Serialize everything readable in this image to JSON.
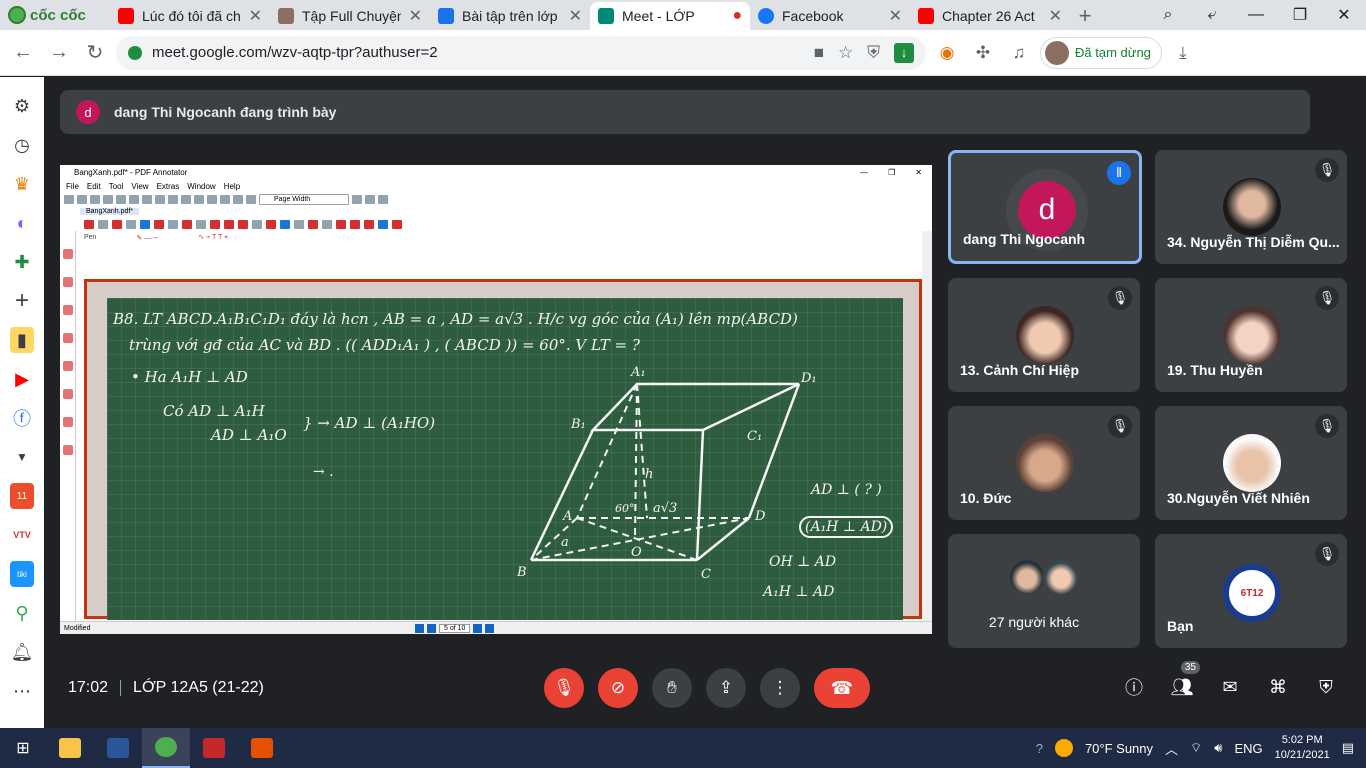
{
  "browser": {
    "brand": "cốc cốc",
    "tabs": [
      {
        "title": "Lúc đó tôi đã ch",
        "color": "#ff0000"
      },
      {
        "title": "Tập Full Chuyện",
        "color": "#8d6e63"
      },
      {
        "title": "Bài tập trên lớp",
        "color": "#1a73e8"
      },
      {
        "title": "Meet - LỚP",
        "color": "#00897b",
        "active": true
      },
      {
        "title": "Facebook",
        "color": "#1877f2"
      },
      {
        "title": "Chapter 26 Act",
        "color": "#ff0000"
      }
    ],
    "url": "meet.google.com/wzv-aqtp-tpr?authuser=2",
    "profile_status": "Đã tạm dừng"
  },
  "meet": {
    "presenting_initial": "d",
    "presenting_banner": "dang Thi Ngocanh đang trình bày",
    "time": "17:02",
    "meeting_name": "LỚP 12A5 (21-22)",
    "participant_count": "35"
  },
  "participants": [
    {
      "name": "dang Thi Ngocanh",
      "initial": "d",
      "speaking": true
    },
    {
      "name": "34. Nguyễn Thị Diễm Qu...",
      "speaking": false
    },
    {
      "name": "13. Cảnh Chí Hiệp",
      "speaking": false
    },
    {
      "name": "19. Thu Huyền",
      "speaking": false
    },
    {
      "name": "10. Đức",
      "speaking": false
    },
    {
      "name": "30.Nguyễn Viết Nhiên",
      "speaking": false
    },
    {
      "name": "27 người khác",
      "speaking": false
    },
    {
      "name": "Bạn",
      "speaking": false
    }
  ],
  "shared_app": {
    "window_title": "BangXanh.pdf* - PDF Annotator",
    "menu": [
      "File",
      "Edit",
      "Tool",
      "View",
      "Extras",
      "Window",
      "Help"
    ],
    "zoom_mode": "Page Width",
    "doc_tab": "BangXanh.pdf*",
    "pen_label": "Pen",
    "status_text": "Modified",
    "page_indicator": "5 of 10"
  },
  "board_text": {
    "line1": "B8.  LT  ABCD.A₁B₁C₁D₁  đáy là hcn ,  AB = a , AD = a√3 .  H/c vg góc của (A₁) lên mp(ABCD)",
    "line2": "trùng với gđ của AC và BD .   (( ADD₁A₁ ) , ( ABCD )) = 60°.    V  LT  = ?",
    "line3": "•  Ha  A₁H ⊥ AD",
    "line4": "Có    AD ⊥ A₁H",
    "line5": "AD ⊥ A₁O",
    "line6": "} → AD ⊥ (A₁HO)",
    "line7": "→ .",
    "r1": "AD ⊥ ( ? )",
    "r2": "(A₁H ⊥ AD)",
    "r3": "OH ⊥ AD",
    "r4": "A₁H ⊥ AD",
    "labels": {
      "A1": "A₁",
      "B1": "B₁",
      "C1": "C₁",
      "D1": "D₁",
      "A": "A",
      "B": "B",
      "C": "C",
      "D": "D",
      "O": "O",
      "a": "a",
      "h": "h",
      "a3": "a√3",
      "ang": "60°"
    }
  },
  "taskbar": {
    "weather": "70°F  Sunny",
    "lang": "ENG",
    "time": "5:02 PM",
    "date": "10/21/2021"
  }
}
